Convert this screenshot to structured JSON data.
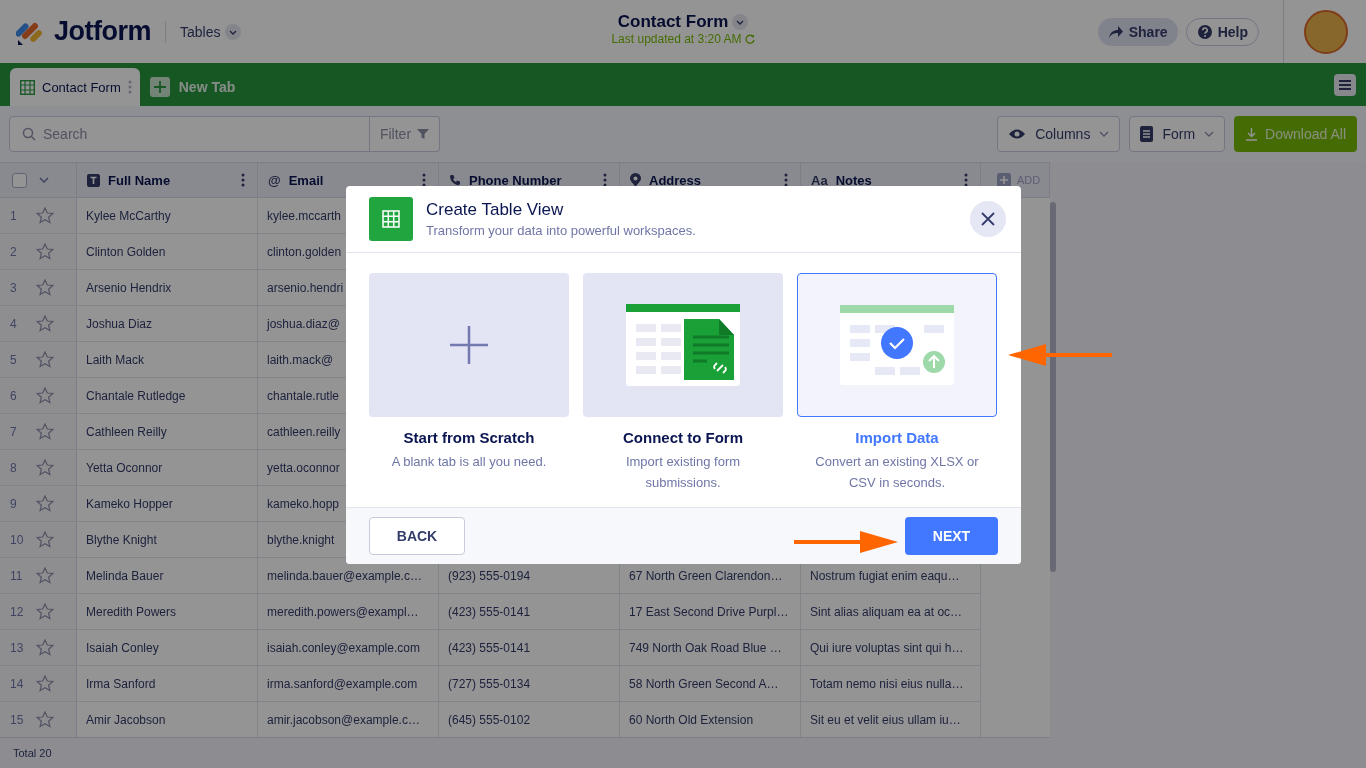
{
  "header": {
    "logo": "Jotform",
    "section": "Tables",
    "title": "Contact Form",
    "updated": "Last updated at 3:20 AM",
    "share": "Share",
    "help": "Help"
  },
  "tabs": [
    {
      "label": "Contact Form",
      "selected": true
    }
  ],
  "new_tab": "New Tab",
  "toolbar": {
    "search_placeholder": "Search",
    "filter": "Filter",
    "columns": "Columns",
    "form": "Form",
    "download": "Download All"
  },
  "table": {
    "select_all_checked": false,
    "columns": [
      {
        "label": "Full Name",
        "kind": "text"
      },
      {
        "label": "Email",
        "kind": "glyph",
        "glyph": "@"
      },
      {
        "label": "Phone Number",
        "kind": "phone"
      },
      {
        "label": "Address",
        "kind": "address"
      },
      {
        "label": "Notes",
        "kind": "glyph",
        "glyph": "Aa"
      }
    ],
    "add": "ADD",
    "rows": [
      {
        "num": "1",
        "starred": false,
        "cells": [
          "Kylee McCarthy",
          "kylee.mccarth"
        ]
      },
      {
        "num": "2",
        "starred": false,
        "cells": [
          "Clinton Golden",
          "clinton.golden"
        ]
      },
      {
        "num": "3",
        "starred": false,
        "cells": [
          "Arsenio Hendrix",
          "arsenio.hendri"
        ]
      },
      {
        "num": "4",
        "starred": false,
        "cells": [
          "Joshua Diaz",
          "joshua.diaz@"
        ]
      },
      {
        "num": "5",
        "starred": false,
        "cells": [
          "Laith Mack",
          "laith.mack@"
        ]
      },
      {
        "num": "6",
        "starred": false,
        "cells": [
          "Chantale Rutledge",
          "chantale.rutle"
        ]
      },
      {
        "num": "7",
        "starred": false,
        "cells": [
          "Cathleen Reilly",
          "cathleen.reilly"
        ]
      },
      {
        "num": "8",
        "starred": false,
        "cells": [
          "Yetta Oconnor",
          "yetta.oconnor"
        ]
      },
      {
        "num": "9",
        "starred": false,
        "cells": [
          "Kameko Hopper",
          "kameko.hopp"
        ]
      },
      {
        "num": "10",
        "starred": false,
        "cells": [
          "Blythe Knight",
          "blythe.knight"
        ]
      },
      {
        "num": "11",
        "starred": false,
        "cells": [
          "Melinda Bauer",
          "melinda.bauer@example.c…",
          "(923) 555-0194",
          "67 North Green Clarendon…",
          "Nostrum fugiat enim eaqu…"
        ]
      },
      {
        "num": "12",
        "starred": false,
        "cells": [
          "Meredith Powers",
          "meredith.powers@exampl…",
          "(423) 555-0141",
          "17 East Second Drive Purpl…",
          "Sint alias aliquam ea at oc…"
        ]
      },
      {
        "num": "13",
        "starred": false,
        "cells": [
          "Isaiah Conley",
          "isaiah.conley@example.com",
          "(423) 555-0141",
          "749 North Oak Road Blue …",
          "Qui iure voluptas sint qui h…"
        ]
      },
      {
        "num": "14",
        "starred": false,
        "cells": [
          "Irma Sanford",
          "irma.sanford@example.com",
          "(727) 555-0134",
          "58 North Green Second A…",
          "Totam nemo nisi eius nulla…"
        ]
      },
      {
        "num": "15",
        "starred": false,
        "cells": [
          "Amir Jacobson",
          "amir.jacobson@example.c…",
          "(645) 555-0102",
          "60 North Old Extension",
          "Sit eu et velit eius ullam iu…"
        ]
      }
    ],
    "total": "Total 20"
  },
  "modal": {
    "title": "Create Table View",
    "subtitle": "Transform your data into powerful workspaces.",
    "options": [
      {
        "kind": "scratch",
        "title": "Start from Scratch",
        "description": "A blank tab is all you need.",
        "selected": false
      },
      {
        "kind": "connect",
        "title": "Connect to Form",
        "description": "Import existing form submissions.",
        "selected": false
      },
      {
        "kind": "import",
        "title": "Import Data",
        "description": "Convert an existing XLSX or CSV in seconds.",
        "selected": true
      }
    ],
    "buttons": [
      {
        "label": "BACK",
        "kind": "secondary"
      },
      {
        "label": "NEXT",
        "kind": "primary"
      }
    ]
  }
}
